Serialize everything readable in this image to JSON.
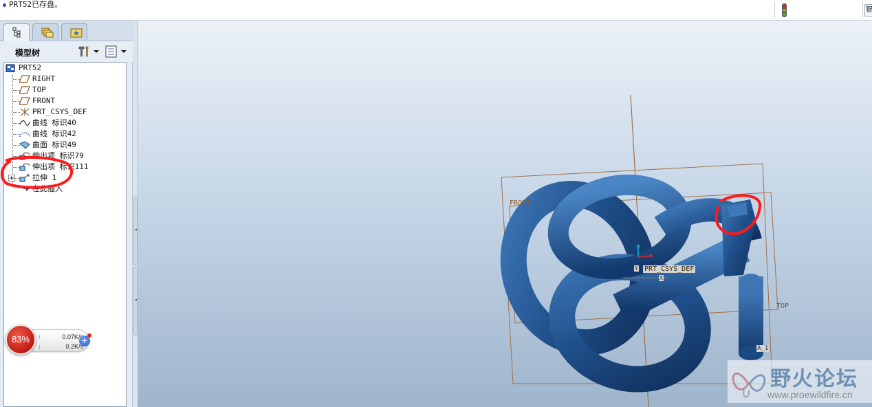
{
  "status": {
    "message": "PRT52已存盘。",
    "corner_label": "智"
  },
  "left_panel": {
    "tabs": [
      {
        "name": "model-tree-tab",
        "icon": "tree-icon"
      },
      {
        "name": "folder-browser-tab",
        "icon": "folders-icon"
      },
      {
        "name": "favorites-tab",
        "icon": "favorites-icon"
      }
    ],
    "tree_title": "模型树",
    "items": [
      {
        "label": "PRT52",
        "icon": "part-icon"
      },
      {
        "label": "RIGHT",
        "icon": "datum-plane-icon"
      },
      {
        "label": "TOP",
        "icon": "datum-plane-icon"
      },
      {
        "label": "FRONT",
        "icon": "datum-plane-icon"
      },
      {
        "label": "PRT_CSYS_DEF",
        "icon": "csys-icon"
      },
      {
        "label": "曲线 标识40",
        "icon": "curve-icon"
      },
      {
        "label": "曲线 标识42",
        "icon": "curve-dotted-icon"
      },
      {
        "label": "曲面 标识49",
        "icon": "surface-icon"
      },
      {
        "label": "伸出项 标识79",
        "icon": "protrusion-icon"
      },
      {
        "label": "伸出项 标识111",
        "icon": "protrusion-icon"
      },
      {
        "label": "拉伸 1",
        "icon": "extrude-icon"
      },
      {
        "label": "在此插入",
        "icon": "insert-arrow-icon"
      }
    ]
  },
  "speed_widget": {
    "percent": "83%",
    "upload": "0.07K/s",
    "download": "0.2K/s",
    "plus": "+"
  },
  "viewport": {
    "datum_labels": {
      "front": "FRONT",
      "top": "TOP",
      "csys": "PRT_CSYS_DEF",
      "x_axis": "X",
      "y_axis": "Y",
      "axis": "A_1"
    }
  },
  "watermark": {
    "title": "野火论坛",
    "url": "www.proewildfire.cn"
  },
  "colors": {
    "model_blue": "#1f4f8a",
    "annotation_red": "#ff1a1a",
    "datum_brown": "#a0704a"
  }
}
